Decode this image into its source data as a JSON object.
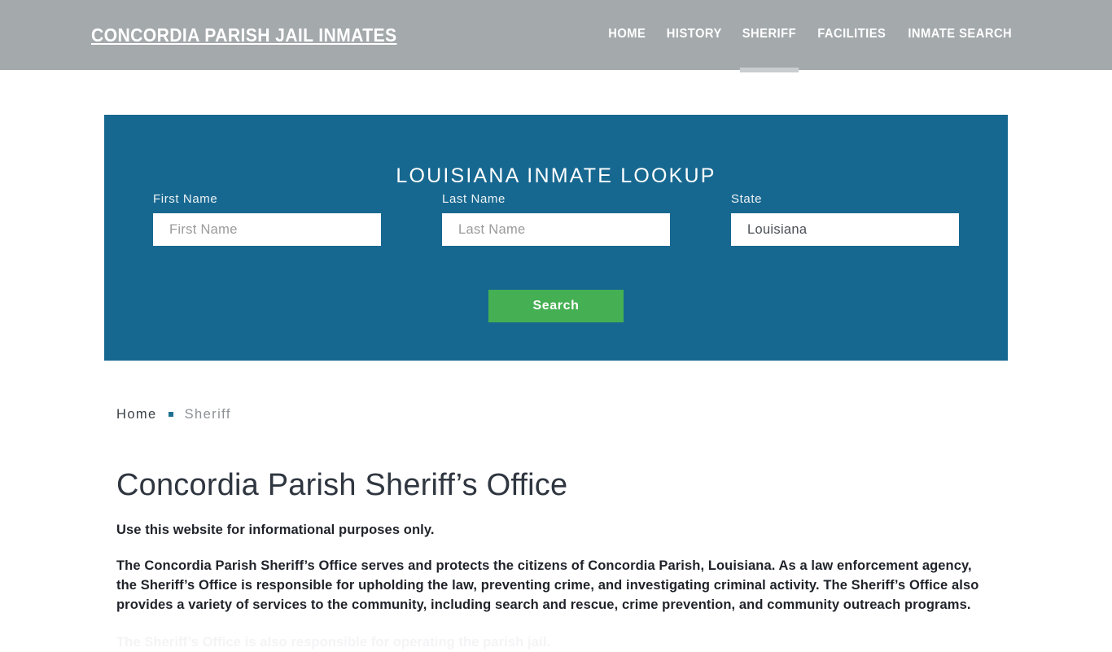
{
  "header": {
    "brand": "Concordia Parish Jail Inmates",
    "nav": [
      {
        "label": "Home",
        "active": false
      },
      {
        "label": "History",
        "active": false
      },
      {
        "label": "Sheriff",
        "active": true
      },
      {
        "label": "Facilities",
        "active": false
      },
      {
        "label": "Inmate Search",
        "active": false
      }
    ],
    "bg_color": "#a4a9ac",
    "active_indicator_color": "#c9cdd0"
  },
  "lookup": {
    "title": "Louisiana Inmate Lookup",
    "panel_color": "#176890",
    "first_name": {
      "label": "First Name",
      "value": "",
      "placeholder": "First Name"
    },
    "last_name": {
      "label": "Last Name",
      "value": "",
      "placeholder": "Last Name"
    },
    "state": {
      "label": "State",
      "value": "Louisiana",
      "options": [
        "Louisiana"
      ]
    },
    "search_button": {
      "label": "Search",
      "color": "#45b053"
    }
  },
  "breadcrumb": {
    "home": "Home",
    "current": "Sheriff",
    "separator_color": "#20708f"
  },
  "main": {
    "title": "Concordia Parish Sheriff’s Office",
    "lead": "Use this website for informational purposes only.",
    "paragraph": "The Concordia Parish Sheriff’s Office serves and protects the citizens of Concordia Parish, Louisiana. As a law enforcement agency, the Sheriff’s Office is responsible for upholding the law, preventing crime, and investigating criminal activity. The Sheriff’s Office also provides a variety of services to the community, including search and rescue, crime prevention, and community outreach programs.",
    "paragraph_next_clipped": "The Sheriff’s Office is also responsible for operating the parish jail."
  }
}
